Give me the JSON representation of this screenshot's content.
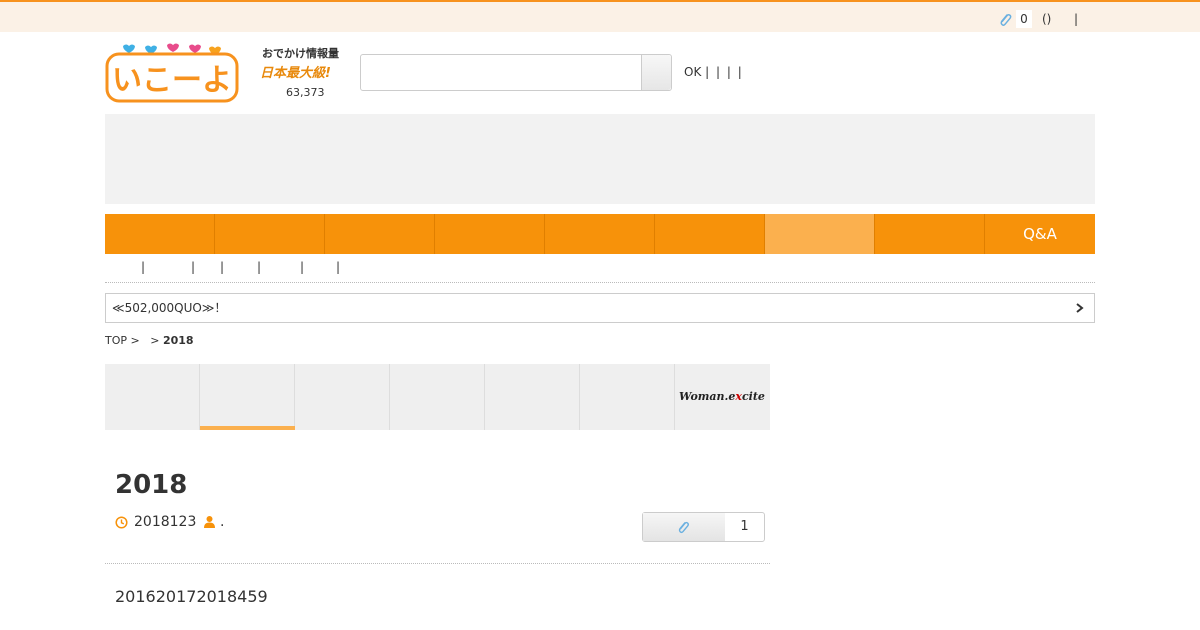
{
  "colors": {
    "accent": "#f7920a",
    "accent_light": "#fbb04e",
    "topbar_bg": "#fbf1e6",
    "clip_blue": "#6ab0e0"
  },
  "topbar": {
    "clip_icon": "paperclip-icon",
    "clip_count": "0",
    "paren": "()",
    "separator": "|"
  },
  "header": {
    "logo_text": "いこーよ",
    "tagline": "おでかけ情報量",
    "biggest": "日本最大級!",
    "spot_count": "63,373",
    "search": {
      "placeholder": "",
      "value": ""
    },
    "links": [
      "OK |",
      "|",
      "|",
      "|"
    ]
  },
  "nav": {
    "items": [
      "",
      "",
      "",
      "",
      "",
      "",
      "",
      "",
      "Q&A"
    ],
    "active_index": 6
  },
  "sub_links": [
    "|",
    "|",
    "|",
    "|",
    "|",
    "|"
  ],
  "campaign": {
    "text": "≪502,000QUO≫！",
    "chevron_icon": "chevron-right-icon"
  },
  "breadcrumb": {
    "items": [
      "TOP",
      ">",
      ">"
    ],
    "current": "2018"
  },
  "tabs": {
    "count": 7,
    "active_index": 1,
    "last_logo": {
      "pre": "Woman.e",
      "x": "x",
      "post": "cite"
    }
  },
  "article": {
    "title": "2018",
    "date": "2018123",
    "author": ".",
    "clip_count": "1",
    "body": "201620172018459"
  }
}
